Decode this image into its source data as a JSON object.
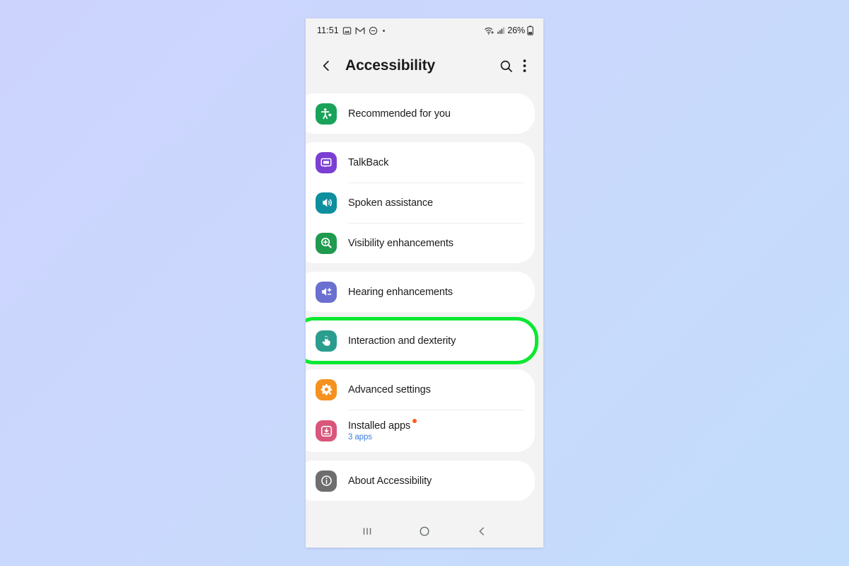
{
  "background": {
    "from": "#ccd4fe",
    "to": "#c2dcfb"
  },
  "statusbar": {
    "time": "11:51",
    "battery_percent": "26%",
    "icons": [
      "gallery-icon",
      "gmail-icon",
      "do-not-disturb-icon",
      "notification-dot-icon"
    ],
    "right_icons": [
      "wifi-calling-icon",
      "signal-bars-icon",
      "battery-icon"
    ]
  },
  "appbar": {
    "title": "Accessibility",
    "back_label": "back-arrow",
    "search_label": "search",
    "menu_label": "more options"
  },
  "highlight": {
    "color": "#0ce832",
    "target": "Interaction and dexterity"
  },
  "groups": [
    {
      "id": "recommended",
      "rows": [
        {
          "id": "recommended-for-you",
          "label": "Recommended for you",
          "icon": "accessibility-person-heart-icon",
          "icon_color": "#19a35a"
        }
      ]
    },
    {
      "id": "vision",
      "rows": [
        {
          "id": "talkback",
          "label": "TalkBack",
          "icon": "speech-bubble-icon",
          "icon_color": "#7b3fd4"
        },
        {
          "id": "spoken-assistance",
          "label": "Spoken assistance",
          "icon": "speaker-sound-icon",
          "icon_color": "#0d8f9e"
        },
        {
          "id": "visibility-enhancements",
          "label": "Visibility enhancements",
          "icon": "magnifier-plus-icon",
          "icon_color": "#1f9a4e"
        }
      ]
    },
    {
      "id": "hearing",
      "rows": [
        {
          "id": "hearing-enhancements",
          "label": "Hearing enhancements",
          "icon": "volume-plus-minus-icon",
          "icon_color": "#6a6fd0"
        }
      ]
    },
    {
      "id": "interaction",
      "highlighted": true,
      "rows": [
        {
          "id": "interaction-and-dexterity",
          "label": "Interaction and dexterity",
          "icon": "hand-tap-icon",
          "icon_color": "#2a9d8f"
        }
      ]
    },
    {
      "id": "advanced",
      "rows": [
        {
          "id": "advanced-settings",
          "label": "Advanced settings",
          "icon": "gear-plus-icon",
          "icon_color": "#f49120"
        },
        {
          "id": "installed-apps",
          "label": "Installed apps",
          "sublabel": "3 apps",
          "badge": true,
          "icon": "download-box-icon",
          "icon_color": "#d9567a"
        }
      ]
    },
    {
      "id": "about",
      "rows": [
        {
          "id": "about-accessibility",
          "label": "About Accessibility",
          "icon": "info-circle-icon",
          "icon_color": "#6e6e6e"
        }
      ]
    }
  ],
  "navbar": {
    "recents": "recents",
    "home": "home",
    "back": "back"
  }
}
